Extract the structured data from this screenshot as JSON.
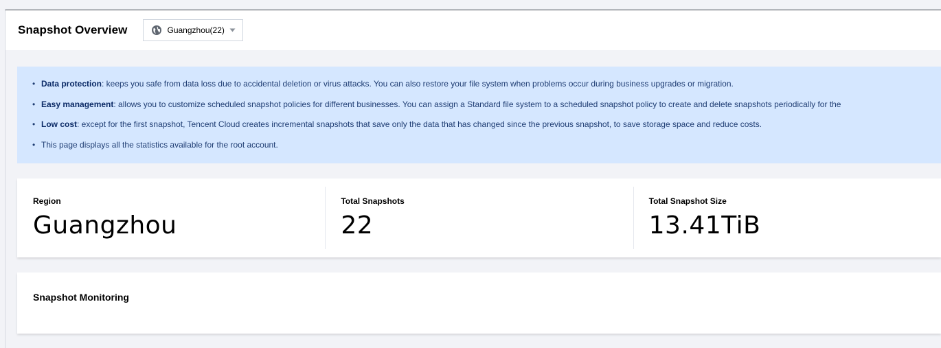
{
  "header": {
    "title": "Snapshot Overview",
    "region_select": {
      "value": "Guangzhou(22)",
      "icon": "globe-icon",
      "caret_icon": "caret-down-icon"
    }
  },
  "info": {
    "items": [
      {
        "bold": "Data protection",
        "text": ": keeps you safe from data loss due to accidental deletion or virus attacks. You can also restore your file system when problems occur during business upgrades or migration."
      },
      {
        "bold": "Easy management",
        "text": ": allows you to customize scheduled snapshot policies for different businesses. You can assign a Standard file system to a scheduled snapshot policy to create and delete snapshots periodically for the"
      },
      {
        "bold": "Low cost",
        "text": ": except for the first snapshot, Tencent Cloud creates incremental snapshots that save only the data that has changed since the previous snapshot, to save storage space and reduce costs."
      },
      {
        "bold": "",
        "text": "This page displays all the statistics available for the root account."
      }
    ]
  },
  "stats": [
    {
      "label": "Region",
      "value": "Guangzhou"
    },
    {
      "label": "Total Snapshots",
      "value": "22"
    },
    {
      "label": "Total Snapshot Size",
      "value": "13.41TiB"
    }
  ],
  "monitoring": {
    "title": "Snapshot Monitoring"
  },
  "colors": {
    "info_bg": "#d5e7ff",
    "info_text": "#1f3d73",
    "page_bg": "#f2f3f7"
  }
}
